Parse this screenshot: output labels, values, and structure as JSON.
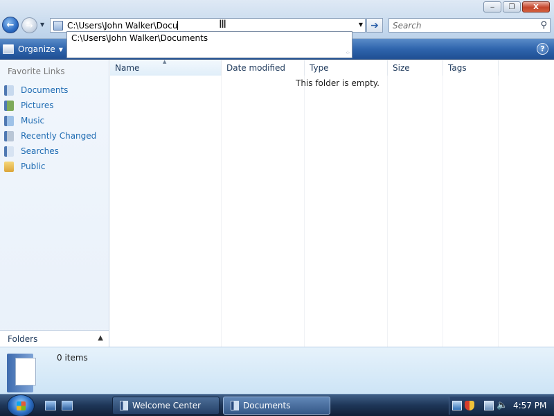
{
  "window": {
    "minimize_glyph": "‒",
    "maximize_glyph": "❐",
    "close_glyph": "X"
  },
  "address": {
    "typed_text": "C:\\Users\\John Walker\\Docu",
    "suggestion": "C:\\Users\\John Walker\\Documents"
  },
  "search": {
    "placeholder": "Search"
  },
  "toolbar": {
    "organize_label": "Organize"
  },
  "nav_pane": {
    "title": "Favorite Links",
    "items": [
      {
        "label": "Documents",
        "icon": "documents-icon"
      },
      {
        "label": "Pictures",
        "icon": "pictures-icon"
      },
      {
        "label": "Music",
        "icon": "music-icon"
      },
      {
        "label": "Recently Changed",
        "icon": "recently-changed-icon"
      },
      {
        "label": "Searches",
        "icon": "searches-icon"
      },
      {
        "label": "Public",
        "icon": "public-folder-icon"
      }
    ],
    "folders_label": "Folders"
  },
  "file_list": {
    "columns": [
      "Name",
      "Date modified",
      "Type",
      "Size",
      "Tags"
    ],
    "empty_message": "This folder is empty."
  },
  "details": {
    "item_count": "0 items"
  },
  "taskbar": {
    "buttons": [
      {
        "label": "Welcome Center"
      },
      {
        "label": "Documents"
      }
    ],
    "clock": "4:57 PM"
  }
}
